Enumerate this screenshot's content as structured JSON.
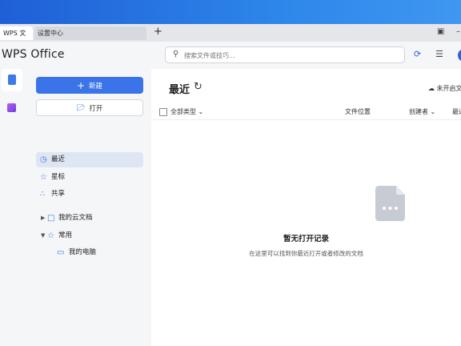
{
  "tabs": [
    {
      "label": "WPS 文字"
    },
    {
      "label": "设置中心"
    }
  ],
  "tab_add": "+",
  "app": {
    "logo": "WPS Office"
  },
  "search": {
    "placeholder": "搜索文件或技巧..."
  },
  "sidebar": {
    "new_label": "新建",
    "open_label": "打开",
    "items": [
      {
        "label": "最近",
        "icon": "clock-icon"
      },
      {
        "label": "星标",
        "icon": "star-icon"
      },
      {
        "label": "共享",
        "icon": "share-icon"
      },
      {
        "label": "我的云文档",
        "icon": "folder-icon"
      },
      {
        "label": "常用",
        "icon": "pin-icon"
      },
      {
        "label": "我的电脑",
        "icon": "computer-icon"
      }
    ]
  },
  "main": {
    "title": "最近",
    "cloud_status": "未开启文",
    "columns": [
      "全部类型",
      "文件位置",
      "创建者",
      "最近"
    ],
    "empty_title": "暂无打开记录",
    "empty_sub": "在这里可以找到你最近打开或者修改的文档"
  },
  "colors": {
    "accent": "#3b74e8",
    "active_bg": "#dfe6f3"
  }
}
